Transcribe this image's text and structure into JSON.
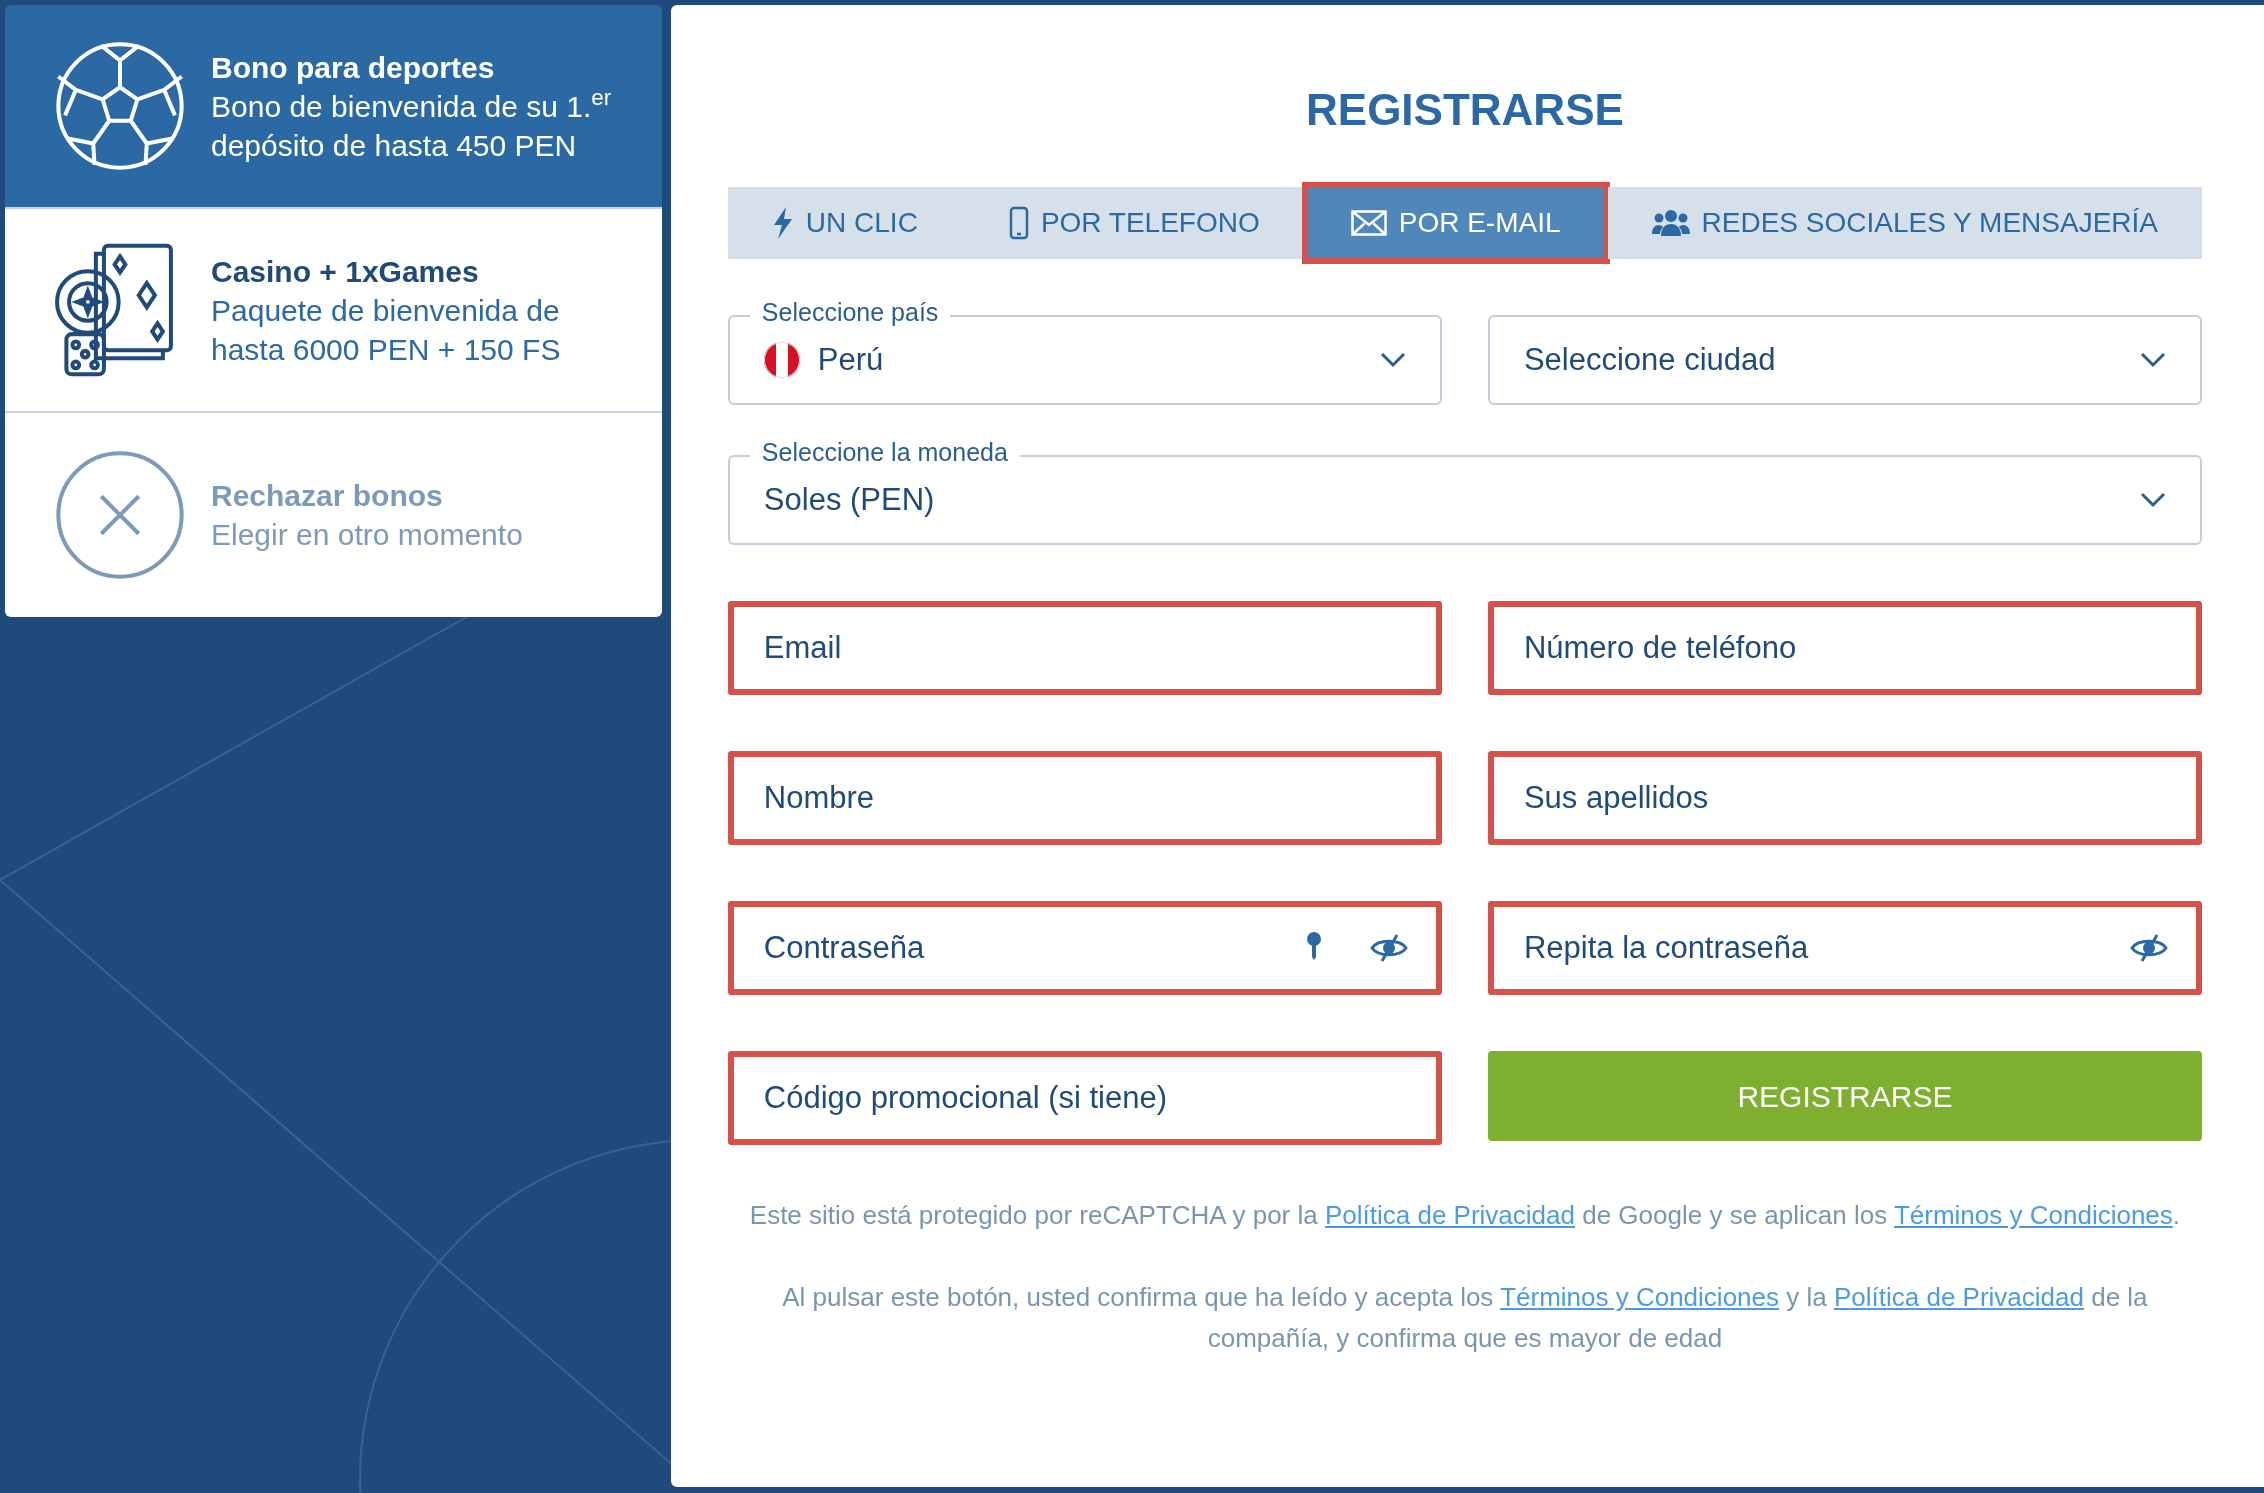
{
  "bonuses": [
    {
      "kind": "sports",
      "title": "Bono para deportes",
      "text": "Bono de bienvenida de su 1.$^{er}$ depósito de hasta 450 PEN",
      "selected": true
    },
    {
      "kind": "casino",
      "title": "Casino + 1xGames",
      "text": "Paquete de bienvenida de hasta 6000 PEN + 150 FS",
      "selected": false
    },
    {
      "kind": "decline",
      "title": "Rechazar bonos",
      "text": "Elegir en otro momento",
      "selected": false
    }
  ],
  "form": {
    "title": "REGISTRARSE",
    "tabs": [
      {
        "kind": "one-click",
        "label": "UN CLIC",
        "selected": false,
        "highlighted": false
      },
      {
        "kind": "phone",
        "label": "POR TELEFONO",
        "selected": false,
        "highlighted": false
      },
      {
        "kind": "email",
        "label": "POR E-MAIL",
        "selected": true,
        "highlighted": true
      },
      {
        "kind": "social",
        "label": "REDES SOCIALES Y MENSAJERÍA",
        "selected": false,
        "highlighted": false
      }
    ],
    "location": [
      {
        "label": "Seleccione país",
        "value": "Perú",
        "flag": true
      },
      {
        "placeholder": "Seleccione ciudad"
      }
    ],
    "currency": {
      "label": "Seleccione la moneda",
      "value": "Soles (PEN)"
    },
    "fields": [
      {
        "kind": "text",
        "placeholder": "Email",
        "highlighted": true
      },
      {
        "kind": "text",
        "placeholder": "Número de teléfono",
        "highlighted": true
      },
      {
        "kind": "text",
        "placeholder": "Nombre",
        "highlighted": true
      },
      {
        "kind": "text",
        "placeholder": "Sus apellidos",
        "highlighted": true
      },
      {
        "kind": "password",
        "placeholder": "Contraseña",
        "highlighted": true,
        "key_icon": true
      },
      {
        "kind": "password",
        "placeholder": "Repita la contraseña",
        "highlighted": true,
        "key_icon": false
      },
      {
        "kind": "text",
        "placeholder": "Código promocional (si tiene)",
        "highlighted": true
      }
    ],
    "submit": "REGISTRARSE",
    "notices": [
      [
        {
          "kind": "text",
          "text": "Este sitio está protegido por reCAPTCHA y por la "
        },
        {
          "kind": "link",
          "text": "Política de Privacidad"
        },
        {
          "kind": "text",
          "text": " de Google y se aplican los "
        },
        {
          "kind": "link",
          "text": "Términos y Condiciones"
        },
        {
          "kind": "text",
          "text": "."
        }
      ],
      [
        {
          "kind": "text",
          "text": "Al pulsar este botón, usted confirma que ha leído y acepta los "
        },
        {
          "kind": "link",
          "text": "Términos y Condiciones"
        },
        {
          "kind": "text",
          "text": " y la "
        },
        {
          "kind": "link",
          "text": "Política de Privacidad"
        },
        {
          "kind": "text",
          "text": " de la compañía, y confirma que es mayor de edad"
        }
      ]
    ]
  }
}
